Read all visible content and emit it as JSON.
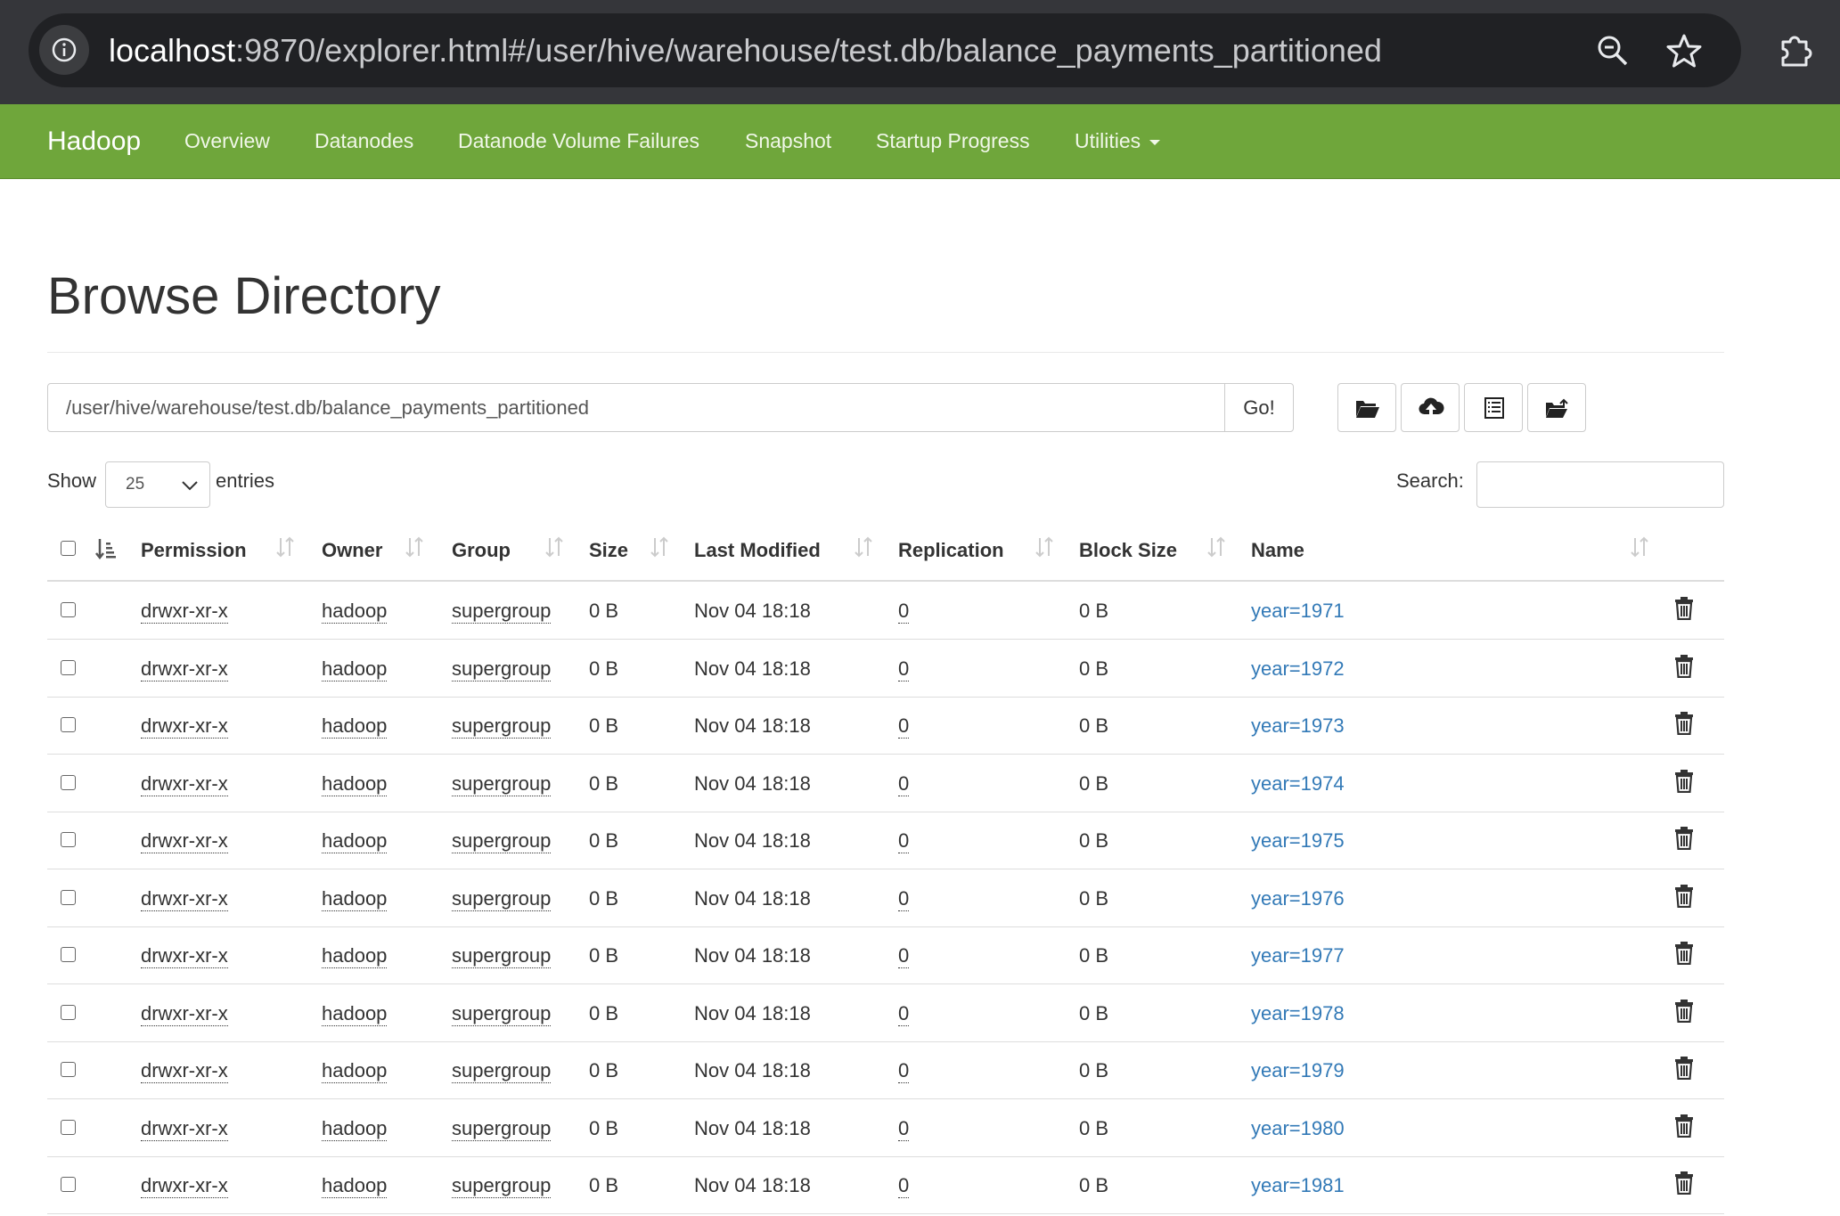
{
  "browser": {
    "url_host": "localhost",
    "url_rest": ":9870/explorer.html#/user/hive/warehouse/test.db/balance_payments_partitioned"
  },
  "navbar": {
    "brand": "Hadoop",
    "items": [
      "Overview",
      "Datanodes",
      "Datanode Volume Failures",
      "Snapshot",
      "Startup Progress",
      "Utilities"
    ]
  },
  "page": {
    "title": "Browse Directory",
    "path_value": "/user/hive/warehouse/test.db/balance_payments_partitioned",
    "go_label": "Go!",
    "show_label": "Show",
    "page_length": "25",
    "entries_label": "entries",
    "search_label": "Search:"
  },
  "table": {
    "headers": {
      "permission": "Permission",
      "owner": "Owner",
      "group": "Group",
      "size": "Size",
      "last_modified": "Last Modified",
      "replication": "Replication",
      "block_size": "Block Size",
      "name": "Name"
    },
    "rows": [
      {
        "permission": "drwxr-xr-x",
        "owner": "hadoop",
        "group": "supergroup",
        "size": "0 B",
        "last_modified": "Nov 04 18:18",
        "replication": "0",
        "block_size": "0 B",
        "name": "year=1971"
      },
      {
        "permission": "drwxr-xr-x",
        "owner": "hadoop",
        "group": "supergroup",
        "size": "0 B",
        "last_modified": "Nov 04 18:18",
        "replication": "0",
        "block_size": "0 B",
        "name": "year=1972"
      },
      {
        "permission": "drwxr-xr-x",
        "owner": "hadoop",
        "group": "supergroup",
        "size": "0 B",
        "last_modified": "Nov 04 18:18",
        "replication": "0",
        "block_size": "0 B",
        "name": "year=1973"
      },
      {
        "permission": "drwxr-xr-x",
        "owner": "hadoop",
        "group": "supergroup",
        "size": "0 B",
        "last_modified": "Nov 04 18:18",
        "replication": "0",
        "block_size": "0 B",
        "name": "year=1974"
      },
      {
        "permission": "drwxr-xr-x",
        "owner": "hadoop",
        "group": "supergroup",
        "size": "0 B",
        "last_modified": "Nov 04 18:18",
        "replication": "0",
        "block_size": "0 B",
        "name": "year=1975"
      },
      {
        "permission": "drwxr-xr-x",
        "owner": "hadoop",
        "group": "supergroup",
        "size": "0 B",
        "last_modified": "Nov 04 18:18",
        "replication": "0",
        "block_size": "0 B",
        "name": "year=1976"
      },
      {
        "permission": "drwxr-xr-x",
        "owner": "hadoop",
        "group": "supergroup",
        "size": "0 B",
        "last_modified": "Nov 04 18:18",
        "replication": "0",
        "block_size": "0 B",
        "name": "year=1977"
      },
      {
        "permission": "drwxr-xr-x",
        "owner": "hadoop",
        "group": "supergroup",
        "size": "0 B",
        "last_modified": "Nov 04 18:18",
        "replication": "0",
        "block_size": "0 B",
        "name": "year=1978"
      },
      {
        "permission": "drwxr-xr-x",
        "owner": "hadoop",
        "group": "supergroup",
        "size": "0 B",
        "last_modified": "Nov 04 18:18",
        "replication": "0",
        "block_size": "0 B",
        "name": "year=1979"
      },
      {
        "permission": "drwxr-xr-x",
        "owner": "hadoop",
        "group": "supergroup",
        "size": "0 B",
        "last_modified": "Nov 04 18:18",
        "replication": "0",
        "block_size": "0 B",
        "name": "year=1980"
      },
      {
        "permission": "drwxr-xr-x",
        "owner": "hadoop",
        "group": "supergroup",
        "size": "0 B",
        "last_modified": "Nov 04 18:18",
        "replication": "0",
        "block_size": "0 B",
        "name": "year=1981"
      }
    ]
  },
  "colors": {
    "navbar": "#6fa63b",
    "link": "#337ab7",
    "chrome": "#35363a"
  },
  "icons": [
    "info-icon",
    "zoom-icon",
    "star-icon",
    "extension-icon",
    "folder-open-icon",
    "cloud-upload-icon",
    "list-alt-icon",
    "folder-move-icon",
    "sort-icon",
    "trash-icon",
    "chevron-down-icon"
  ]
}
